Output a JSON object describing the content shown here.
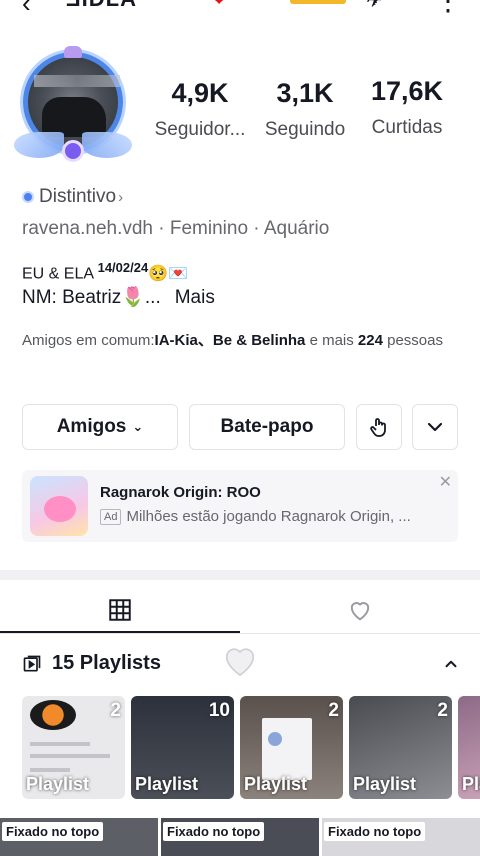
{
  "header": {
    "back_glyph": "‹",
    "handle_fragment": "ƎIDLA",
    "more_glyph": "⋮"
  },
  "stats": [
    {
      "value": "4,9K",
      "label": "Seguidor..."
    },
    {
      "value": "3,1K",
      "label": "Seguindo"
    },
    {
      "value": "17,6K",
      "label": "Curtidas"
    }
  ],
  "profile": {
    "badge_label": "Distintivo",
    "meta_line": "ravena.neh.vdh · Feminino · Aquário",
    "bio_line1_text": "EU & ELA ",
    "bio_line1_date": "14/02/24",
    "bio_line1_emojis": "🥺💌",
    "bio_line2_text": "NM: Beatriz🌷...",
    "bio_more": "Mais",
    "mutual_prefix": "Amigos em comum:",
    "mutual_names": "IA-Kia、Be & Belinha",
    "mutual_middle": " e mais ",
    "mutual_count": "224",
    "mutual_suffix": " pessoas"
  },
  "actions": {
    "friends_label": "Amigos",
    "chat_label": "Bate-papo"
  },
  "ad": {
    "title": "Ragnarok Origin: ROO",
    "tag": "Ad",
    "subtitle": "Milhões estão jogando Ragnarok Origin, ...",
    "close_glyph": "✕"
  },
  "tabs": [
    {
      "name": "grid",
      "icon": "grid-icon",
      "active": true
    },
    {
      "name": "liked",
      "icon": "heart-outline-icon",
      "active": false
    }
  ],
  "playlists": {
    "title": "15 Playlists",
    "items": [
      {
        "count": "2",
        "label": "Playlist",
        "bg": "#e9e9ec"
      },
      {
        "count": "10",
        "label": "Playlist",
        "bg": "#3b3f4a"
      },
      {
        "count": "2",
        "label": "Playlist",
        "bg": "#7d7470"
      },
      {
        "count": "2",
        "label": "Playlist",
        "bg": "#6c6d73"
      },
      {
        "count": "",
        "label": "Pla",
        "bg": "#b58aa4"
      }
    ]
  },
  "pinned": [
    {
      "label": "Fixado no topo"
    },
    {
      "label": "Fixado no topo"
    },
    {
      "label": "Fixado no topo"
    }
  ],
  "colors": {
    "text_primary": "#161823",
    "text_secondary": "#66686e",
    "badge_blue": "#4d7ff0",
    "avatar_ring": "#4d86e8"
  }
}
